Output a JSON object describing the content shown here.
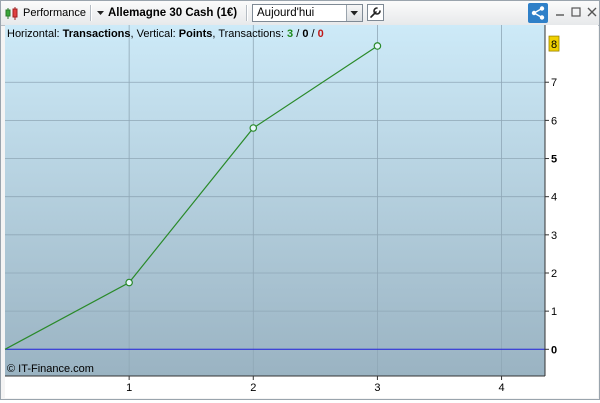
{
  "toolbar": {
    "performance_label": "Performance",
    "instrument_label": "Allemagne 30 Cash (1€)",
    "period_select": "Aujourd'hui"
  },
  "info": {
    "horizontal_prefix": "Horizontal: ",
    "horizontal_value": "Transactions",
    "vertical_prefix": ", Vertical: ",
    "vertical_value": "Points",
    "transactions_prefix": ", Transactions: ",
    "tx_winning": "3",
    "tx_sep1": " / ",
    "tx_neutral": "0",
    "tx_sep2": " / ",
    "tx_losing": "0"
  },
  "copyright": "© IT-Finance.com",
  "colors": {
    "line": "#2a8a2a",
    "zero_line": "#2222dd",
    "highlight_label_bg": "#f0d000",
    "plot_top": "#cdeaf8",
    "plot_bottom": "#9ab3c2"
  },
  "icons": [
    "candlestick-chart-icon",
    "chevron-down-icon",
    "wrench-icon",
    "share-icon",
    "minimize-icon",
    "maximize-icon",
    "close-icon"
  ],
  "chart_data": {
    "type": "line",
    "xlabel": "",
    "ylabel": "",
    "x_ticks": [
      "1",
      "2",
      "3",
      "4"
    ],
    "y_ticks": [
      "0",
      "1",
      "2",
      "3",
      "4",
      "5",
      "6",
      "7"
    ],
    "highlighted_y_label": "8",
    "xlim": [
      0,
      4.35
    ],
    "ylim": [
      -0.7,
      8.5
    ],
    "grid": true,
    "series": [
      {
        "x": [
          0,
          1,
          2,
          3
        ],
        "y": [
          0,
          1.75,
          5.8,
          7.95
        ],
        "markers": [
          1,
          2,
          3
        ]
      }
    ]
  }
}
